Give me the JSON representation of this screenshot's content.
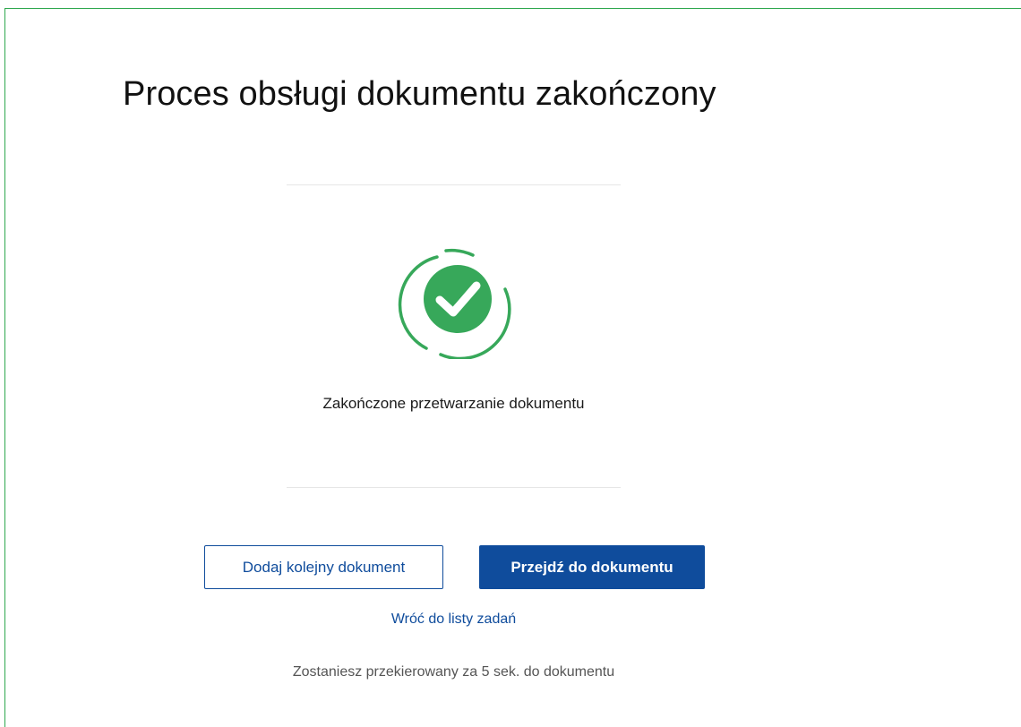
{
  "page": {
    "title": "Proces obsługi dokumentu zakończony"
  },
  "status": {
    "icon": "check-circle-icon",
    "message": "Zakończone przetwarzanie dokumentu"
  },
  "actions": {
    "add_another_label": "Dodaj kolejny dokument",
    "go_to_document_label": "Przejdź do dokumentu",
    "back_to_tasks_label": "Wróć do listy zadań"
  },
  "redirect": {
    "message": "Zostaniesz przekierowany za 5 sek. do dokumentu"
  },
  "colors": {
    "success": "#37a85a",
    "primary": "#0f4c9c",
    "frame": "#2fa84f"
  }
}
